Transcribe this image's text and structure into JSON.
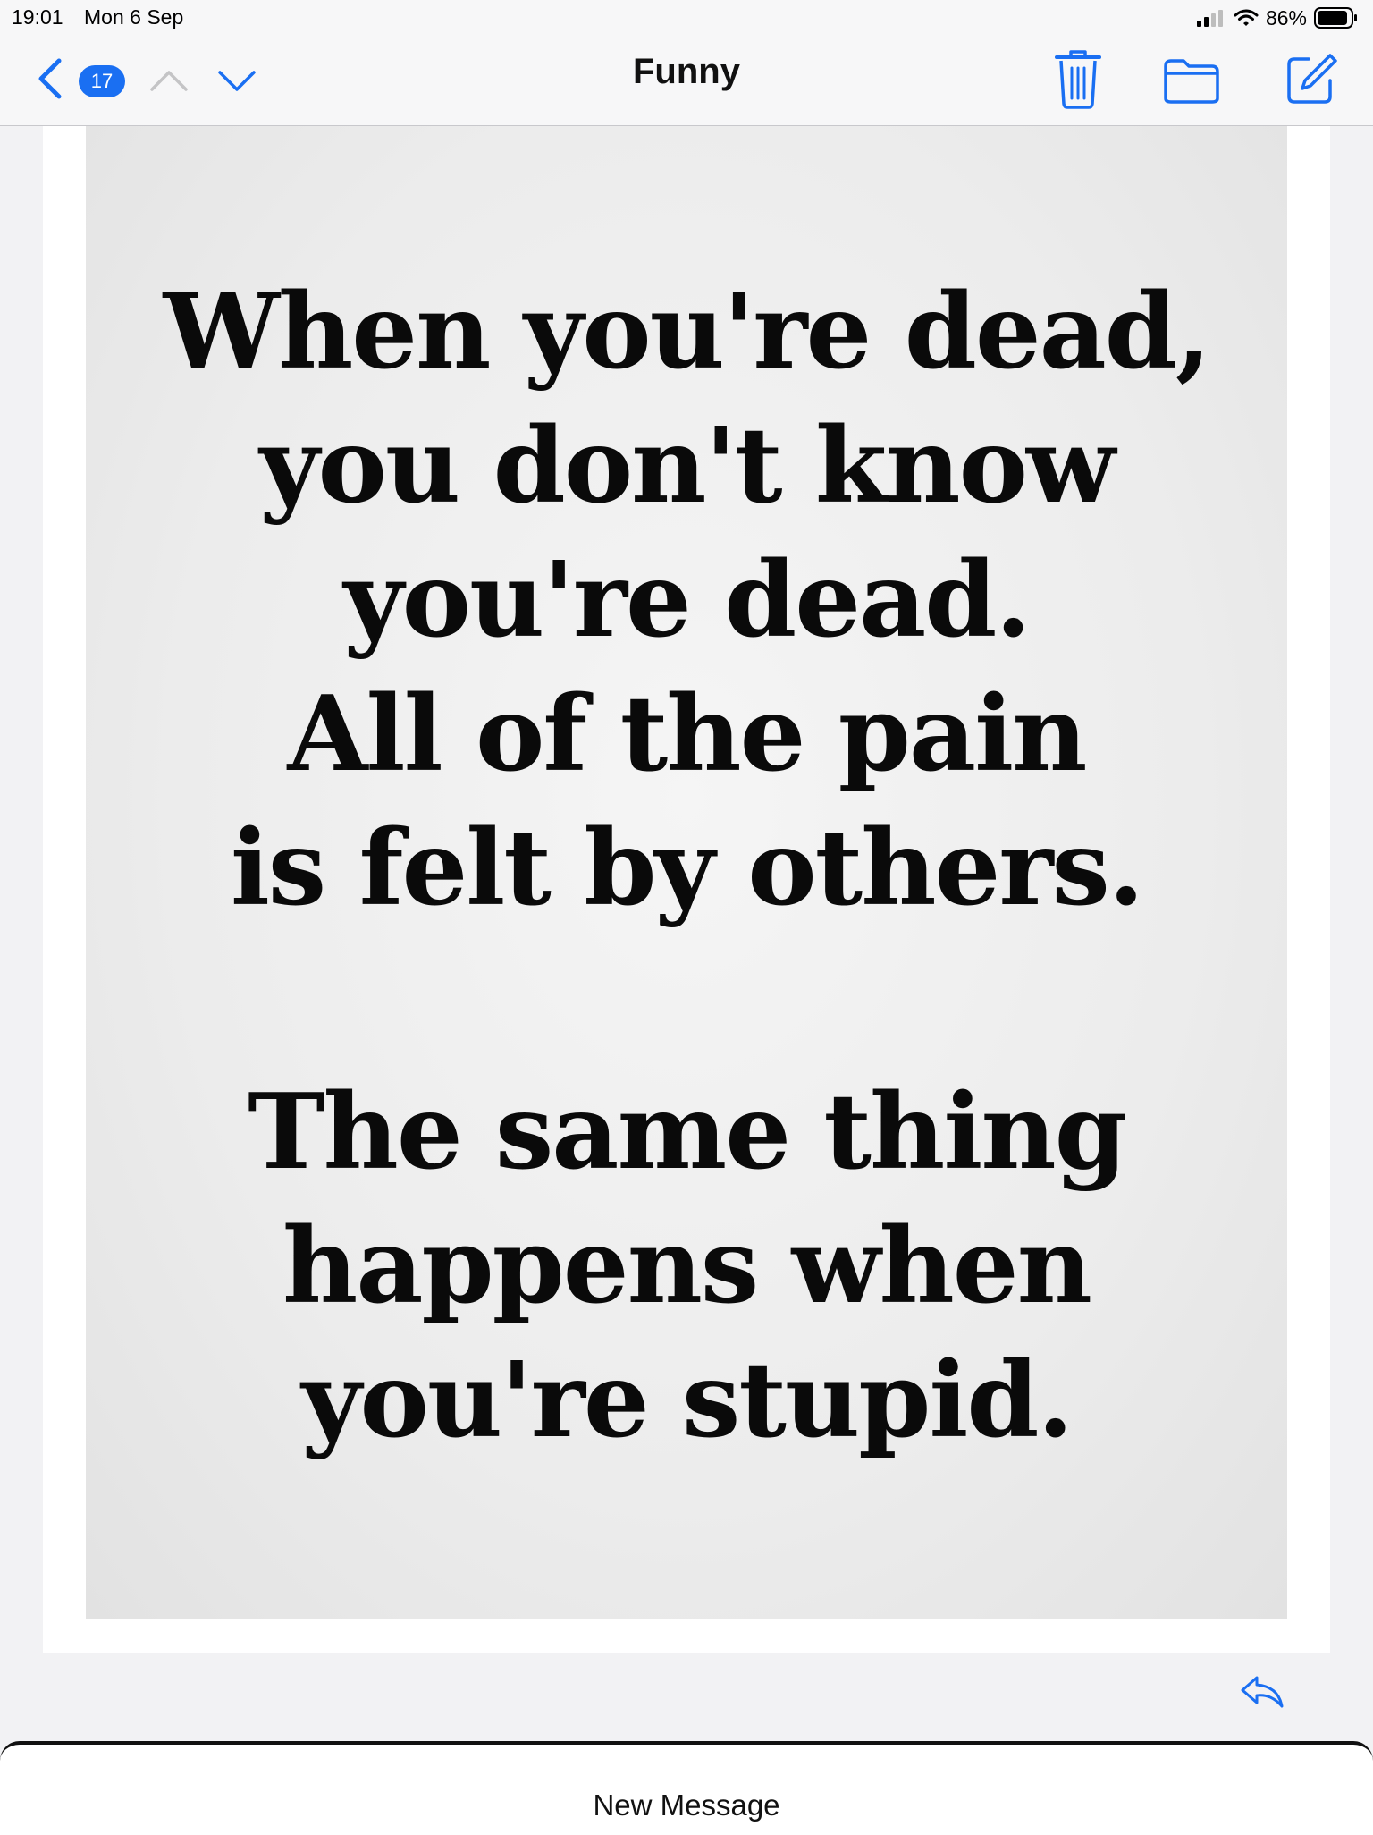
{
  "status_bar": {
    "time": "19:01",
    "date": "Mon 6 Sep",
    "battery_percent": "86%",
    "icons": [
      "signal-icon",
      "wifi-icon",
      "battery-icon"
    ]
  },
  "nav": {
    "title": "Funny",
    "unread_count": "17",
    "accent_color": "#1a6ff2",
    "icons": [
      "back-chevron-icon",
      "up-chevron-icon",
      "down-chevron-icon",
      "trash-icon",
      "folder-icon",
      "compose-icon"
    ]
  },
  "message": {
    "quote_part1": [
      "When you're dead,",
      "you don't know",
      "you're dead.",
      "All of the pain",
      "is felt by others."
    ],
    "quote_part2": [
      "The same thing",
      "happens when",
      "you're stupid."
    ],
    "icons": [
      "reply-icon"
    ]
  },
  "bottom_sheet": {
    "label": "New Message"
  }
}
